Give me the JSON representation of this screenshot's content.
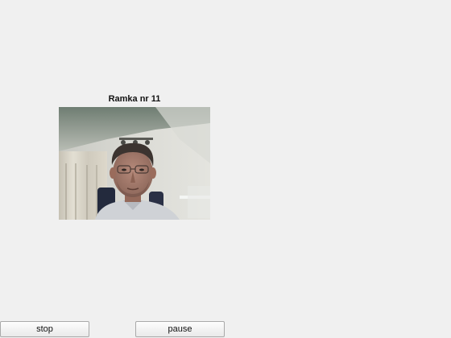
{
  "frame": {
    "title": "Ramka nr 11",
    "content": "webcam-photo"
  },
  "controls": {
    "stop_label": "stop",
    "pause_label": "pause"
  }
}
